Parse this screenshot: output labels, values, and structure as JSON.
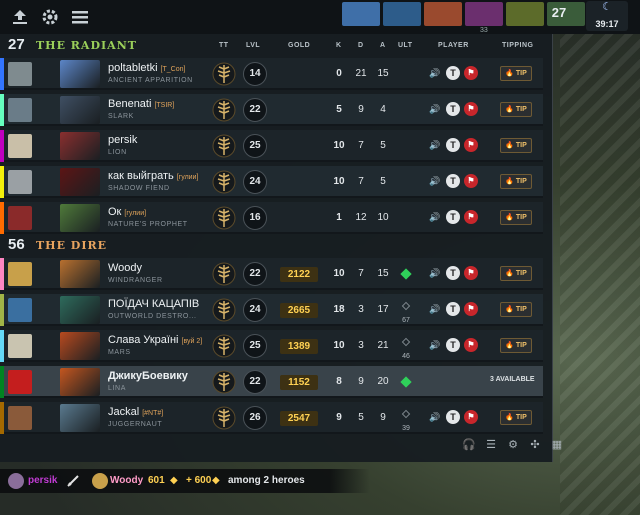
{
  "topbar": {
    "score": "27",
    "clock": "39:17",
    "small_label": "33",
    "hero_colors": [
      "#3f6fa8",
      "#2d5c8a",
      "#9a4a2e",
      "#6b2f6e",
      "#5c6b2a",
      "#3a5c3a"
    ]
  },
  "radiant": {
    "score": "27",
    "name": "THE RADIANT",
    "players": [
      {
        "name": "poltabletki",
        "guild": "[T_Con]",
        "hero": "ANCIENT APPARITION",
        "level": "14",
        "k": "0",
        "d": "21",
        "a": "15",
        "color": "#3375ff",
        "avatar": "#7f8b8f",
        "portrait": "#5c86c8"
      },
      {
        "name": "Benenati",
        "guild": "[TSIR]",
        "hero": "SLARK",
        "level": "22",
        "k": "5",
        "d": "9",
        "a": "4",
        "color": "#66ffbf",
        "avatar": "#6a7c88",
        "portrait": "#3f4f63"
      },
      {
        "name": "persik",
        "guild": "",
        "hero": "LION",
        "level": "25",
        "k": "10",
        "d": "7",
        "a": "5",
        "color": "#bf00bf",
        "avatar": "#c9bfa8",
        "portrait": "#8a2f2f"
      },
      {
        "name": "как выйграть",
        "guild": "[гулии]",
        "hero": "SHADOW FIEND",
        "level": "24",
        "k": "10",
        "d": "7",
        "a": "5",
        "color": "#f3f00b",
        "avatar": "#9aa0a4",
        "portrait": "#5c1515"
      },
      {
        "name": "Ок",
        "guild": "[гулии]",
        "hero": "NATURE'S PROPHET",
        "level": "16",
        "k": "1",
        "d": "12",
        "a": "10",
        "color": "#ff6b00",
        "avatar": "#8a2a2a",
        "portrait": "#4f7a3a"
      }
    ]
  },
  "dire": {
    "score": "56",
    "name": "THE DIRE",
    "players": [
      {
        "name": "Woody",
        "guild": "",
        "hero": "WINDRANGER",
        "level": "22",
        "gold": "2122",
        "k": "10",
        "d": "7",
        "a": "15",
        "ult_count": "",
        "ult": "ready",
        "color": "#fe86c2",
        "avatar": "#c8a04a",
        "portrait": "#b8702f"
      },
      {
        "name": "ПОЇДАЧ КАЦАПІВ",
        "guild": "",
        "hero": "OUTWORLD DESTRO...",
        "level": "24",
        "gold": "2665",
        "k": "18",
        "d": "3",
        "a": "17",
        "ult_count": "67",
        "ult": "cooldown",
        "color": "#a1b447",
        "avatar": "#3a6fa0",
        "portrait": "#2e6b5c"
      },
      {
        "name": "Слава Україні",
        "guild": "[вуй 2]",
        "hero": "MARS",
        "level": "25",
        "gold": "1389",
        "k": "10",
        "d": "3",
        "a": "21",
        "ult_count": "46",
        "ult": "cooldown",
        "color": "#65d9f7",
        "avatar": "#c9c4b0",
        "portrait": "#b84a1f"
      },
      {
        "name": "ДжикуБоевику",
        "guild": "",
        "hero": "LINA",
        "level": "22",
        "gold": "1152",
        "k": "8",
        "d": "9",
        "a": "20",
        "ult_count": "",
        "ult": "ready",
        "color": "#008321",
        "avatar": "#c41e1e",
        "portrait": "#c4561f",
        "highlight": true,
        "avail": "3 AVAILABLE"
      },
      {
        "name": "Jackal",
        "guild": "[#NT#]",
        "hero": "JUGGERNAUT",
        "level": "26",
        "gold": "2547",
        "k": "9",
        "d": "5",
        "a": "9",
        "ult_count": "39",
        "ult": "cooldown",
        "color": "#a46900",
        "avatar": "#8a5a3a",
        "portrait": "#5a7a8f"
      }
    ]
  },
  "headers": {
    "tt": "TT",
    "lvl": "LVL",
    "gold": "GOLD",
    "k": "K",
    "d": "D",
    "a": "A",
    "ult": "ULT",
    "player": "PLAYER",
    "tipping": "TIPPING"
  },
  "tip_label": "TIP",
  "bottom": {
    "player1": "persik",
    "player2": "Woody",
    "gold1": "601",
    "gold2": "+ 600",
    "suffix": "among 2 heroes"
  }
}
